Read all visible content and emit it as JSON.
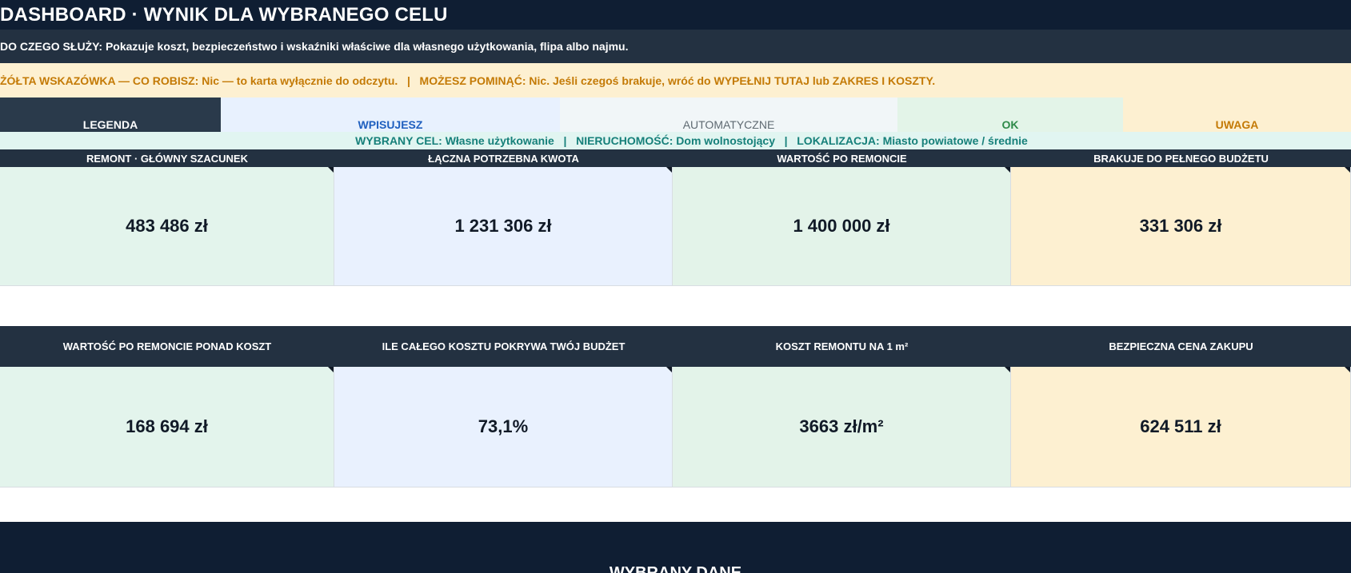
{
  "title": "DASHBOARD · WYNIK DLA WYBRANEGO CELU",
  "info": "DO CZEGO SŁUŻY: Pokazuje koszt, bezpieczeństwo i wskaźniki właściwe dla własnego użytkowania, flipa albo najmu.",
  "hint": "ŻÓŁTA WSKAZÓWKA — CO ROBISZ: Nic — to karta wyłącznie do odczytu.   |   MOŻESZ POMINĄĆ: Nic. Jeśli czegoś brakuje, wróć do WYPEŁNIJ TUTAJ lub ZAKRES I KOSZTY.",
  "legend": {
    "label": "LEGENDA",
    "input": "WPISUJESZ",
    "auto": "AUTOMATYCZNE",
    "ok": "OK",
    "warn": "UWAGA"
  },
  "goal": "WYBRANY CEL: Własne użytkowanie   |   NIERUCHOMOŚĆ: Dom wolnostojący   |   LOKALIZACJA: Miasto powiatowe / średnie",
  "kpi_row_1": [
    {
      "label": "REMONT · GŁÓWNY SZACUNEK",
      "value": "483 486 zł"
    },
    {
      "label": "ŁĄCZNA POTRZEBNA KWOTA",
      "value": "1 231 306 zł"
    },
    {
      "label": "WARTOŚĆ PO REMONCIE",
      "value": "1 400 000 zł"
    },
    {
      "label": "BRAKUJE DO PEŁNEGO BUDŻETU",
      "value": "331 306 zł"
    }
  ],
  "kpi_row_2": [
    {
      "label": "WARTOŚĆ PO REMONCIE PONAD KOSZT",
      "value": "168 694 zł"
    },
    {
      "label": "ILE CAŁEGO KOSZTU POKRYWA TWÓJ BUDŻET",
      "value": "73,1%"
    },
    {
      "label": "KOSZT REMONTU NA 1 m²",
      "value": "3663 zł/m²"
    },
    {
      "label": "BEZPIECZNA CENA ZAKUPU",
      "value": "624 511 zł"
    }
  ],
  "footer": "WYBRANY DANE"
}
